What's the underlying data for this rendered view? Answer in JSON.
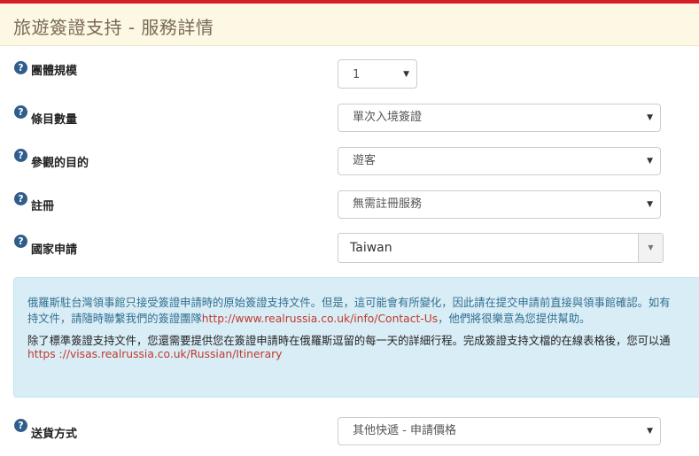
{
  "header": {
    "title": "旅遊簽證支持 - 服務詳情"
  },
  "icons": {
    "help": "question-circle-icon",
    "dropdown": "caret-down-icon"
  },
  "colors": {
    "top_bar": "#d41f26",
    "help_icon": "#2f5d8c",
    "info_bg": "#d9edf7",
    "link": "#c0392b"
  },
  "form": {
    "group_size": {
      "label": "團體規模",
      "value": "1"
    },
    "entries": {
      "label": "條目數量",
      "value": "單次入境簽證"
    },
    "purpose": {
      "label": "參觀的目的",
      "value": "遊客"
    },
    "registration": {
      "label": "註冊",
      "value": "無需註冊服務"
    },
    "country": {
      "label": "國家申請",
      "value": "Taiwan"
    },
    "delivery": {
      "label": "送貨方式",
      "value": "其他快遞 - 申請價格"
    }
  },
  "info": {
    "line1": "俄羅斯駐台灣領事館只接受簽證申請時的原始簽證支持文件。但是，這可能會有所變化，因此請在提交申請前直接與領事館確認。如有",
    "line2_prefix": "持文件，請隨時聯繫我們的簽證團隊",
    "line2_link": "http://www.realrussia.co.uk/info/Contact-Us",
    "line2_suffix": "，他們將很樂意為您提供幫助。",
    "line3": "除了標準簽證支持文件，您還需要提供您在簽證申請時在俄羅斯逗留的每一天的詳細行程。完成簽證支持文檔的在線表格後，您可以通",
    "line4_link": "https ://visas.realrussia.co.uk/Russian/Itinerary"
  }
}
